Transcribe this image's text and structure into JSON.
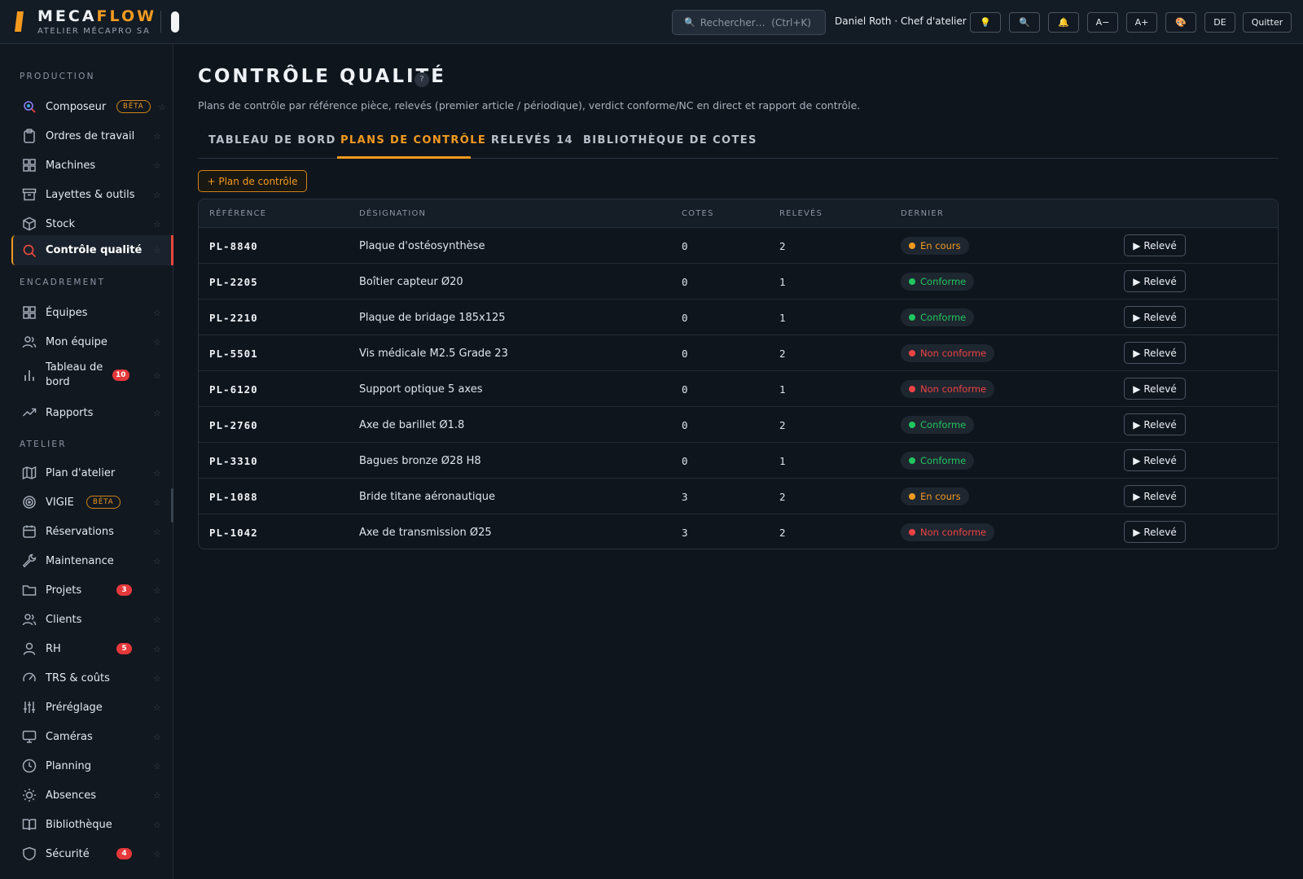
{
  "topbar": {
    "brand_part1": "MECA",
    "brand_part2": "FLOW",
    "brand_sub": "ATELIER MÉCAPRO SA",
    "search_placeholder": "Rechercher…  (Ctrl+K)",
    "user": "Daniel Roth · Chef d'atelier",
    "font_minus": "A−",
    "font_plus": "A+",
    "lang": "DE",
    "quit": "Quitter"
  },
  "sidebar": {
    "sections": {
      "production": "PRODUCTION",
      "encadrement": "ENCADREMENT",
      "atelier": "ATELIER"
    },
    "items": [
      {
        "label": "Composeur",
        "badge": "BÊTA",
        "icon": "composer-icon"
      },
      {
        "label": "Ordres de travail",
        "icon": "clipboard-icon"
      },
      {
        "label": "Machines",
        "icon": "grid-icon"
      },
      {
        "label": "Layettes & outils",
        "icon": "archive-icon"
      },
      {
        "label": "Stock",
        "icon": "box-icon"
      },
      {
        "label": "Contrôle qualité",
        "icon": "search-icon",
        "active": true
      },
      {
        "label": "Équipes",
        "icon": "grid-icon"
      },
      {
        "label": "Mon équipe",
        "icon": "users-icon"
      },
      {
        "label": "Tableau de bord",
        "count": "10",
        "icon": "bar-chart-icon"
      },
      {
        "label": "Rapports",
        "icon": "trending-icon"
      },
      {
        "label": "Plan d'atelier",
        "icon": "map-icon"
      },
      {
        "label": "VIGIE",
        "badge": "BÊTA",
        "icon": "target-icon"
      },
      {
        "label": "Réservations",
        "icon": "calendar-icon"
      },
      {
        "label": "Maintenance",
        "icon": "wrench-icon"
      },
      {
        "label": "Projets",
        "count": "3",
        "icon": "folder-icon"
      },
      {
        "label": "Clients",
        "icon": "users-icon"
      },
      {
        "label": "RH",
        "count": "5",
        "icon": "user-icon"
      },
      {
        "label": "TRS & coûts",
        "icon": "gauge-icon"
      },
      {
        "label": "Préréglage",
        "icon": "sliders-icon"
      },
      {
        "label": "Caméras",
        "icon": "monitor-icon"
      },
      {
        "label": "Planning",
        "icon": "clock-icon"
      },
      {
        "label": "Absences",
        "icon": "sun-icon"
      },
      {
        "label": "Bibliothèque",
        "icon": "book-icon"
      },
      {
        "label": "Sécurité",
        "count": "4",
        "icon": "shield-icon"
      }
    ]
  },
  "page": {
    "title": "CONTRÔLE QUALITÉ",
    "help": "?",
    "subtitle": "Plans de contrôle par référence pièce, relevés (premier article / périodique), verdict conforme/NC en direct et rapport de contrôle.",
    "tabs": [
      "TABLEAU DE BORD",
      "PLANS DE CONTRÔLE",
      "RELEVÉS 14",
      "BIBLIOTHÈQUE DE COTES"
    ],
    "active_tab": 1,
    "add_button": "+ Plan de contrôle"
  },
  "table": {
    "headers": [
      "RÉFÉRENCE",
      "DÉSIGNATION",
      "COTES",
      "RELEVÉS",
      "DERNIER"
    ],
    "action_label": "▶ Relevé",
    "status_colors": {
      "En cours": "#f39a1e",
      "Conforme": "#22c55e",
      "Non conforme": "#ef4444"
    },
    "rows": [
      {
        "ref": "PL-8840",
        "designation": "Plaque d'ostéosynthèse",
        "cotes": "0",
        "releves": "2",
        "status": "En cours"
      },
      {
        "ref": "PL-2205",
        "designation": "Boîtier capteur Ø20",
        "cotes": "0",
        "releves": "1",
        "status": "Conforme"
      },
      {
        "ref": "PL-2210",
        "designation": "Plaque de bridage 185x125",
        "cotes": "0",
        "releves": "1",
        "status": "Conforme"
      },
      {
        "ref": "PL-5501",
        "designation": "Vis médicale M2.5 Grade 23",
        "cotes": "0",
        "releves": "2",
        "status": "Non conforme"
      },
      {
        "ref": "PL-6120",
        "designation": "Support optique 5 axes",
        "cotes": "0",
        "releves": "1",
        "status": "Non conforme"
      },
      {
        "ref": "PL-2760",
        "designation": "Axe de barillet Ø1.8",
        "cotes": "0",
        "releves": "2",
        "status": "Conforme"
      },
      {
        "ref": "PL-3310",
        "designation": "Bagues bronze Ø28 H8",
        "cotes": "0",
        "releves": "1",
        "status": "Conforme"
      },
      {
        "ref": "PL-1088",
        "designation": "Bride titane aéronautique",
        "cotes": "3",
        "releves": "2",
        "status": "En cours"
      },
      {
        "ref": "PL-1042",
        "designation": "Axe de transmission Ø25",
        "cotes": "3",
        "releves": "2",
        "status": "Non conforme"
      }
    ]
  }
}
